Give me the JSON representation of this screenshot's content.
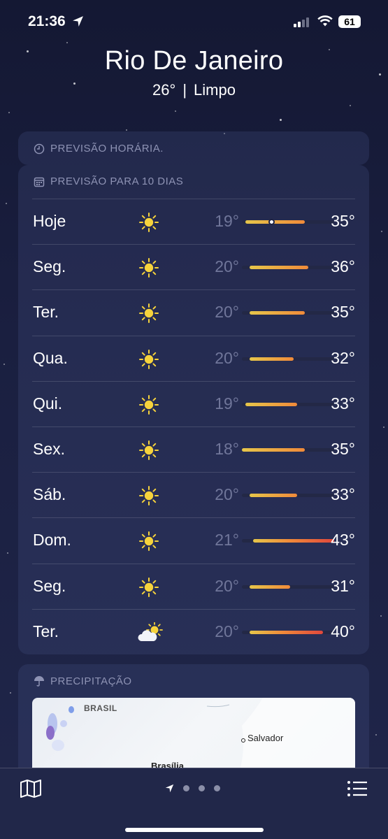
{
  "status_bar": {
    "time": "21:36",
    "location_icon": "location-arrow-icon",
    "battery": "61"
  },
  "header": {
    "city": "Rio De Janeiro",
    "temperature": "26°",
    "separator": "|",
    "condition": "Limpo"
  },
  "hourly": {
    "title": "PREVISÃO HORÁRIA.",
    "icon": "clock-icon"
  },
  "ten_day": {
    "title": "PREVISÃO PARA 10 DIAS",
    "icon": "calendar-icon",
    "range_min": 18,
    "range_max": 43,
    "current_temp": 26,
    "days": [
      {
        "day": "Hoje",
        "icon": "sun-icon",
        "low": "19°",
        "high": "35°",
        "low_val": 19,
        "high_val": 35
      },
      {
        "day": "Seg.",
        "icon": "sun-icon",
        "low": "20°",
        "high": "36°",
        "low_val": 20,
        "high_val": 36
      },
      {
        "day": "Ter.",
        "icon": "sun-icon",
        "low": "20°",
        "high": "35°",
        "low_val": 20,
        "high_val": 35
      },
      {
        "day": "Qua.",
        "icon": "sun-icon",
        "low": "20°",
        "high": "32°",
        "low_val": 20,
        "high_val": 32
      },
      {
        "day": "Qui.",
        "icon": "sun-icon",
        "low": "19°",
        "high": "33°",
        "low_val": 19,
        "high_val": 33
      },
      {
        "day": "Sex.",
        "icon": "sun-icon",
        "low": "18°",
        "high": "35°",
        "low_val": 18,
        "high_val": 35
      },
      {
        "day": "Sáb.",
        "icon": "sun-icon",
        "low": "20°",
        "high": "33°",
        "low_val": 20,
        "high_val": 33
      },
      {
        "day": "Dom.",
        "icon": "sun-icon",
        "low": "21°",
        "high": "43°",
        "low_val": 21,
        "high_val": 43
      },
      {
        "day": "Seg.",
        "icon": "sun-icon",
        "low": "20°",
        "high": "31°",
        "low_val": 20,
        "high_val": 31
      },
      {
        "day": "Ter.",
        "icon": "partly-cloudy-icon",
        "low": "20°",
        "high": "40°",
        "low_val": 20,
        "high_val": 40
      }
    ]
  },
  "precipitation": {
    "title": "PRECIPITAÇÃO",
    "icon": "umbrella-icon",
    "map": {
      "country_label": "BRASIL",
      "cities": [
        "Salvador",
        "Brasília"
      ]
    }
  },
  "bottom_bar": {
    "map_icon": "map-icon",
    "list_icon": "list-icon",
    "page_count": 3
  },
  "colors": {
    "background": "#1a1f40",
    "temp_bar_cool": "#e6c64a",
    "temp_bar_warm": "#f08a3a",
    "temp_bar_hot": "#e0473c"
  }
}
